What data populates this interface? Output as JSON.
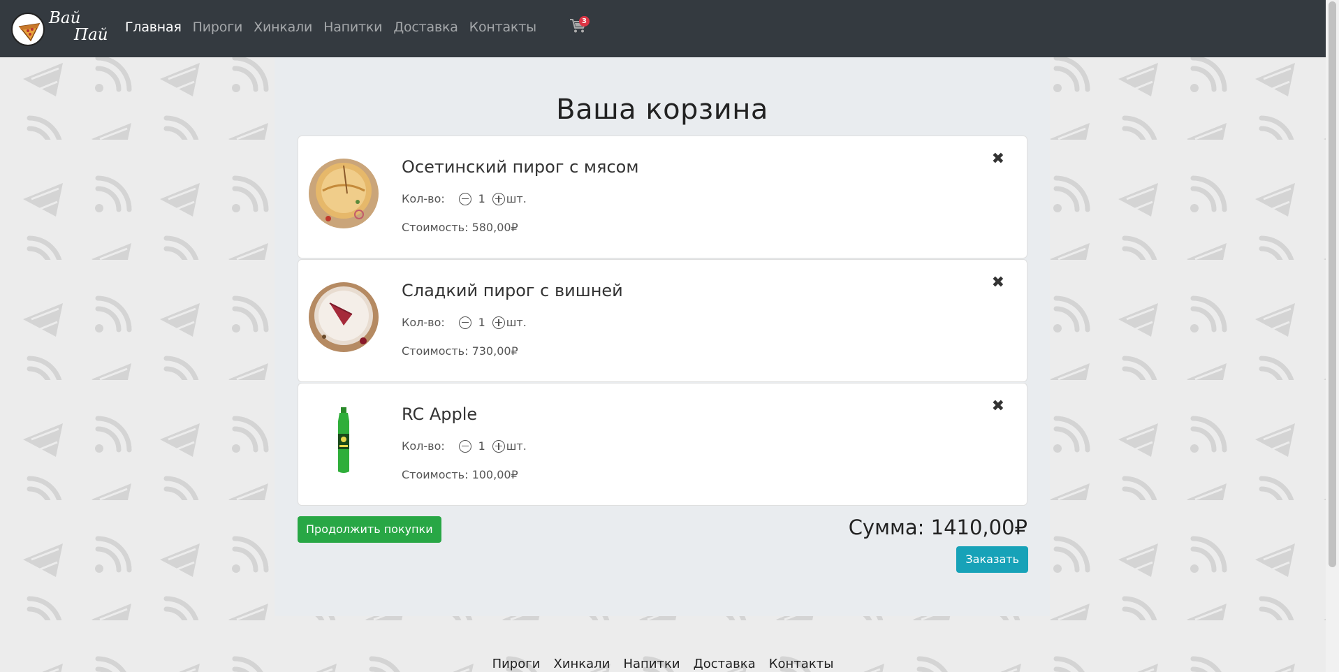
{
  "brand": {
    "line1": "Вай",
    "line2": "Пай"
  },
  "nav": {
    "items": [
      "Главная",
      "Пироги",
      "Хинкали",
      "Напитки",
      "Доставка",
      "Контакты"
    ],
    "cart_count": "3"
  },
  "cart": {
    "title": "Ваша корзина",
    "qty_label": "Кол-во:",
    "unit": "шт.",
    "items": [
      {
        "name": "Осетинский пирог с мясом",
        "qty": "1",
        "price": "Стоимость: 580,00₽",
        "image": "meat-pie-image"
      },
      {
        "name": "Сладкий пирог с вишней",
        "qty": "1",
        "price": "Стоимость: 730,00₽",
        "image": "cherry-pie-image"
      },
      {
        "name": "RC Apple",
        "qty": "1",
        "price": "Стоимость: 100,00₽",
        "image": "soda-bottle-image"
      }
    ],
    "remove_symbol": "✖",
    "continue_label": "Продолжить покупки",
    "total": "Сумма: 1410,00₽",
    "order_label": "Заказать"
  },
  "footer": {
    "links": [
      "Пироги",
      "Хинкали",
      "Напитки",
      "Доставка",
      "Контакты"
    ]
  },
  "colors": {
    "navbar": "#343a40",
    "success": "#28a745",
    "info": "#17a2b8",
    "badge": "#dc3545"
  }
}
